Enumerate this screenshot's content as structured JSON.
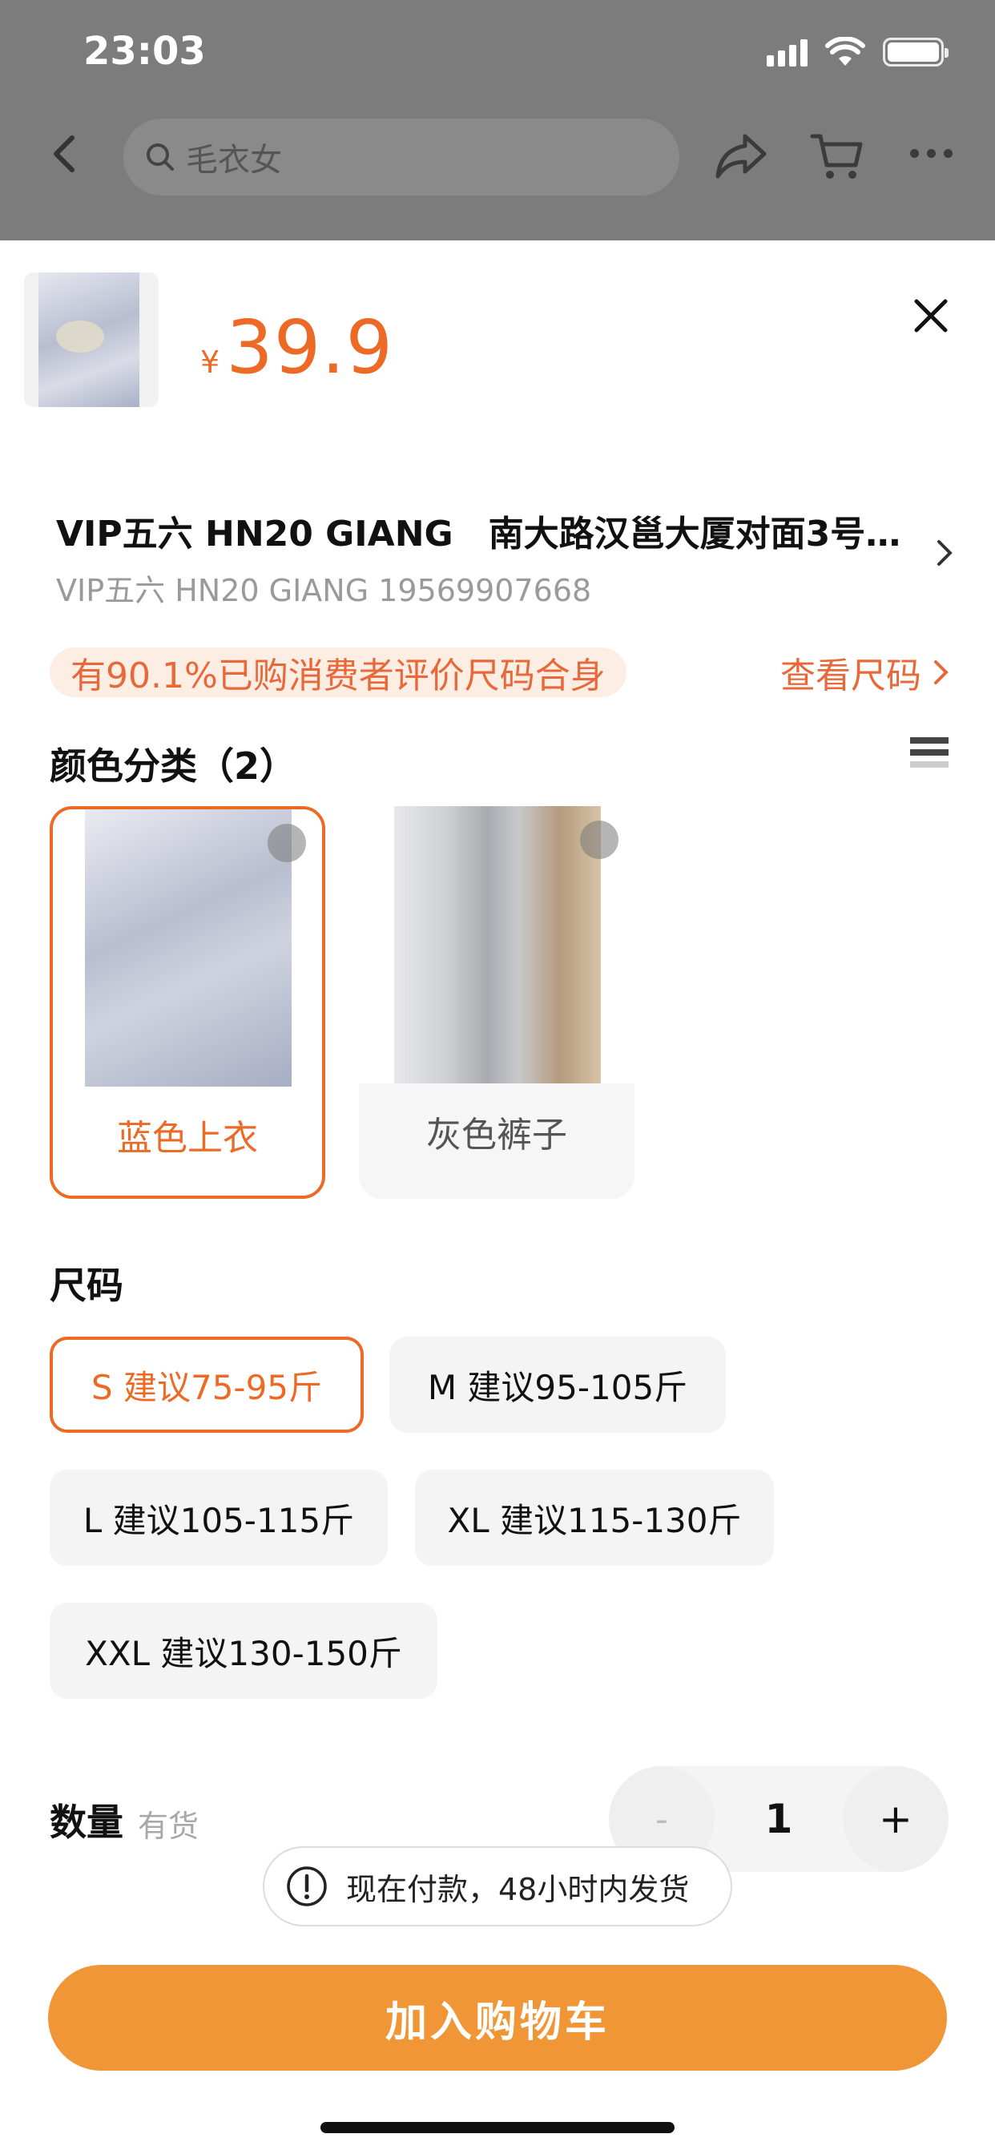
{
  "status_bar": {
    "time": "23:03"
  },
  "nav": {
    "search_placeholder": "毛衣女"
  },
  "product": {
    "currency": "¥",
    "price": "39.9"
  },
  "address": {
    "line1": "VIP五六 HN20 GIANG　南大路汉邕大厦对面3号...",
    "line2": "VIP五六  HN20 GIANG 19569907668"
  },
  "fit": {
    "tag": "有90.1%已购消费者评价尺码合身",
    "link": "查看尺码"
  },
  "color_section": {
    "title": "颜色分类（2）",
    "options": [
      {
        "label": "蓝色上衣",
        "selected": true
      },
      {
        "label": "灰色裤子",
        "selected": false
      }
    ]
  },
  "size_section": {
    "title": "尺码",
    "options": [
      {
        "label": "S 建议75-95斤",
        "selected": true
      },
      {
        "label": "M 建议95-105斤",
        "selected": false
      },
      {
        "label": "L 建议105-115斤",
        "selected": false
      },
      {
        "label": "XL 建议115-130斤",
        "selected": false
      },
      {
        "label": "XXL 建议130-150斤",
        "selected": false
      }
    ]
  },
  "quantity": {
    "label": "数量",
    "stock": "有货",
    "minus": "-",
    "value": "1",
    "plus": "+"
  },
  "notice": {
    "text": "现在付款，48小时内发货"
  },
  "cta": {
    "label": "加入购物车"
  },
  "colors": {
    "accent": "#ec6a25",
    "cta": "#f09637"
  }
}
